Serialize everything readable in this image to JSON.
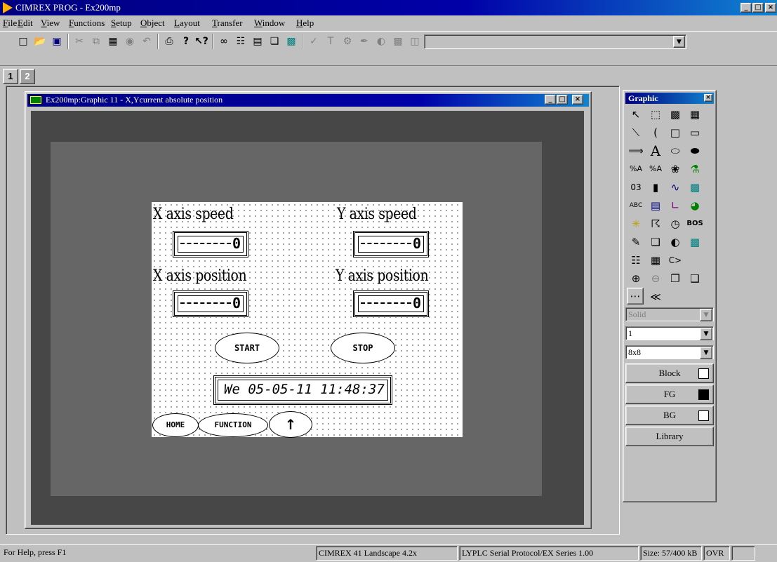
{
  "app": {
    "title": "CIMREX PROG - Ex200mp"
  },
  "menu": [
    "File",
    "Edit",
    "View",
    "Functions",
    "Setup",
    "Object",
    "Layout",
    "Transfer",
    "Window",
    "Help"
  ],
  "page_tabs": [
    "1",
    "2"
  ],
  "child_window": {
    "title": "Ex200mp:Graphic 11 - X,Ycurrent absolute position"
  },
  "screen": {
    "x_speed_label": "X axis speed",
    "y_speed_label": "Y axis speed",
    "x_pos_label": "X axis position",
    "y_pos_label": "Y axis position",
    "x_speed_value": "0",
    "y_speed_value": "0",
    "x_pos_value": "0",
    "y_pos_value": "0",
    "start_label": "START",
    "stop_label": "STOP",
    "datetime": "We 05-05-11 11:48:37",
    "home_label": "HOME",
    "function_label": "FUNCTION",
    "up_label": "↑"
  },
  "palette": {
    "title": "Graphic",
    "fill_style": "Solid",
    "line_width": "1",
    "grid": "8x8",
    "block_label": "Block",
    "fg_label": "FG",
    "bg_label": "BG",
    "library_label": "Library"
  },
  "status": {
    "help": "For Help, press F1",
    "terminal": "CIMREX 41 Landscape 4.2x",
    "protocol": "LYPLC Serial Protocol/EX Series 1.00",
    "size": "Size: 57/400 kB",
    "mode": "OVR"
  },
  "colors": {
    "titlebar": "#000080",
    "face": "#c0c0c0",
    "canvas_dark": "#474747",
    "canvas_gray": "#666666"
  }
}
